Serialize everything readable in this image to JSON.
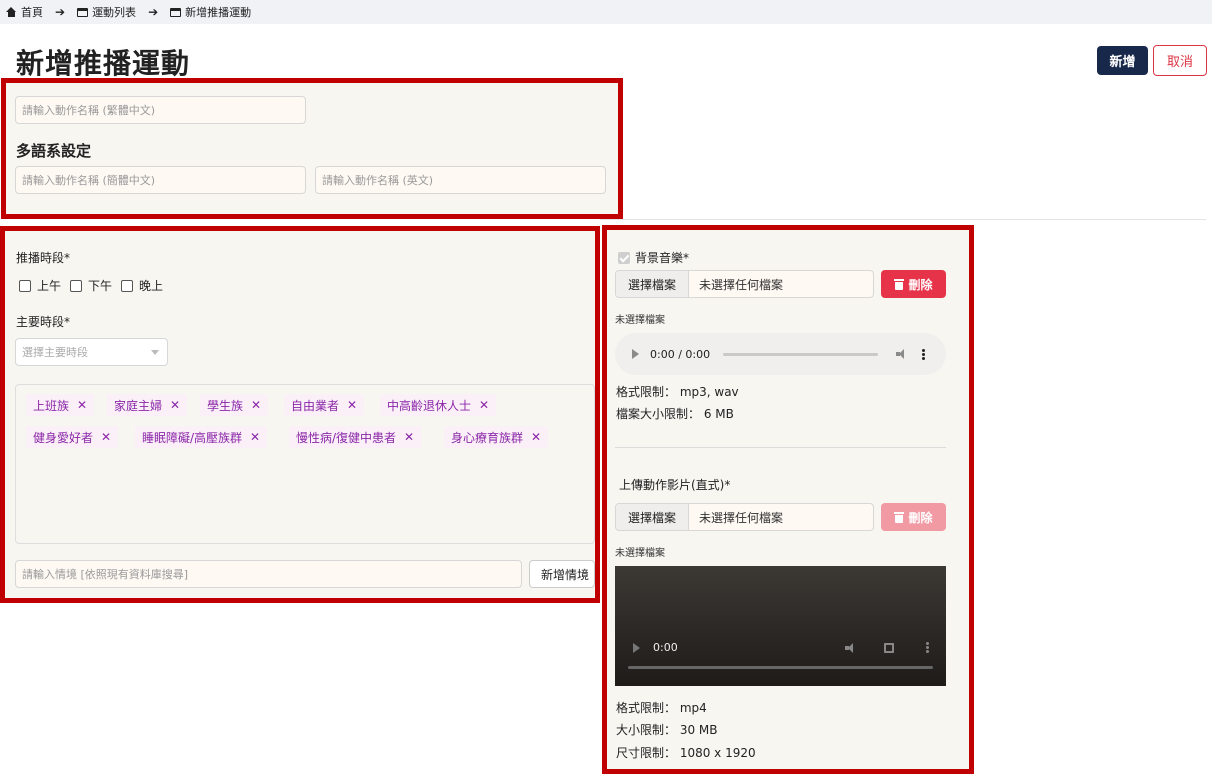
{
  "breadcrumb": [
    {
      "label": "首頁",
      "icon": "house-icon"
    },
    {
      "label": "運動列表",
      "icon": "card-icon"
    },
    {
      "label": "新增推播運動",
      "icon": "card-icon"
    }
  ],
  "page_title": "新增推播運動",
  "actions": {
    "add_label": "新增",
    "cancel_label": "取消"
  },
  "names": {
    "tc_placeholder": "請輸入動作名稱 (繁體中文)",
    "multilang_title": "多語系設定",
    "sc_placeholder": "請輸入動作名稱 (簡體中文)",
    "en_placeholder": "請輸入動作名稱 (英文)"
  },
  "schedule": {
    "push_label": "推播時段*",
    "options": [
      "上午",
      "下午",
      "晚上"
    ],
    "main_label": "主要時段*",
    "main_placeholder": "選擇主要時段"
  },
  "tags": [
    "上班族",
    "家庭主婦",
    "學生族",
    "自由業者",
    "中高齡退休人士",
    "健身愛好者",
    "睡眠障礙/高壓族群",
    "慢性病/復健中患者",
    "身心療育族群"
  ],
  "tag_remove": "✕",
  "scenario": {
    "placeholder": "請輸入情境 [依照現有資料庫搜尋]",
    "button_label": "新增情境"
  },
  "music": {
    "label": "背景音樂*",
    "choose_label": "選擇檔案",
    "no_file": "未選擇任何檔案",
    "delete_label": "刪除",
    "status": "未選擇檔案",
    "time": "0:00 / 0:00",
    "format": "格式限制： mp3, wav",
    "size": "檔案大小限制： 6 MB"
  },
  "video": {
    "label": "上傳動作影片(直式)*",
    "choose_label": "選擇檔案",
    "no_file": "未選擇任何檔案",
    "delete_label": "刪除",
    "status": "未選擇檔案",
    "time": "0:00",
    "format": "格式限制： mp4",
    "size": "大小限制： 30 MB",
    "dimension": "尺寸限制： 1080 x 1920"
  },
  "colors": {
    "primary": "#18284a",
    "danger": "#e6334a",
    "highlight": "#c00000",
    "tag_text": "#8b27a8",
    "panel_bg": "#f8f6f1"
  }
}
